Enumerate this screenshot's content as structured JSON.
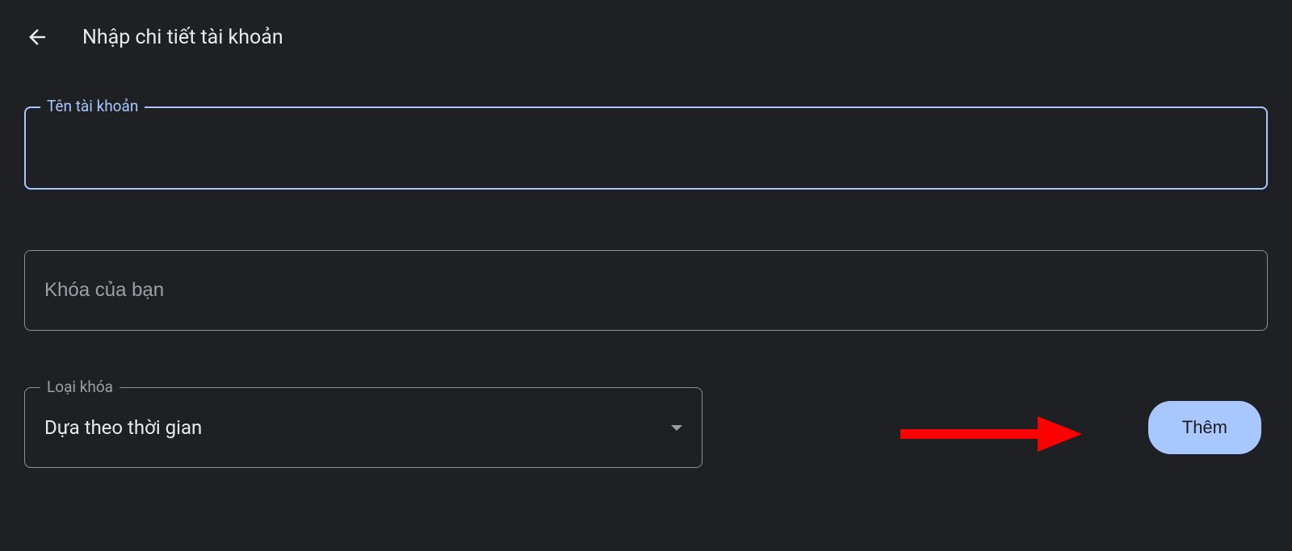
{
  "header": {
    "title": "Nhập chi tiết tài khoản"
  },
  "form": {
    "account_name": {
      "label": "Tên tài khoản",
      "value": ""
    },
    "your_key": {
      "placeholder": "Khóa của bạn",
      "value": ""
    },
    "key_type": {
      "label": "Loại khóa",
      "selected": "Dựa theo thời gian"
    }
  },
  "actions": {
    "add_label": "Thêm"
  }
}
